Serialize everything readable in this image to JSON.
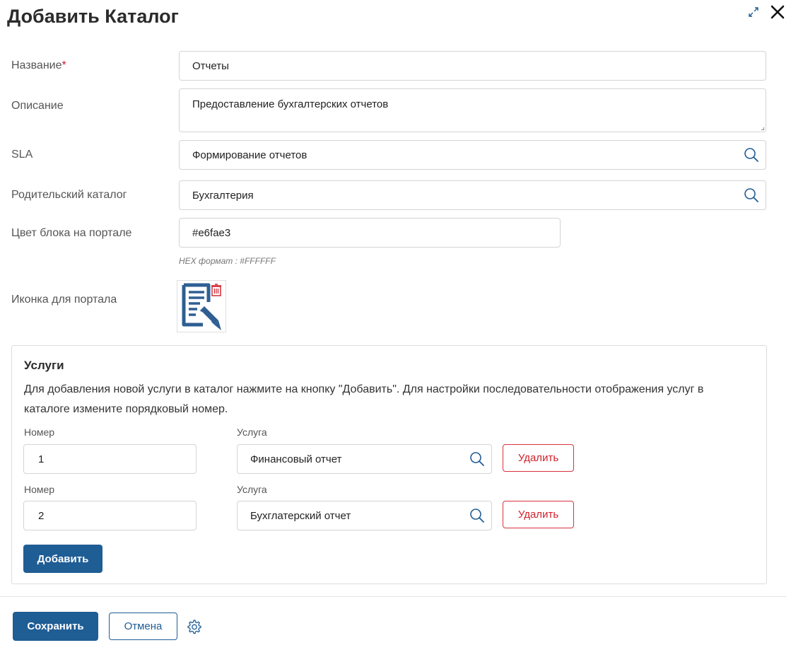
{
  "dialog": {
    "title": "Добавить Каталог"
  },
  "form": {
    "name": {
      "label": "Название",
      "required_mark": "*",
      "value": "Отчеты"
    },
    "description": {
      "label": "Описание",
      "value": "Предоставление бухгалтерских отчетов"
    },
    "sla": {
      "label": "SLA",
      "value": "Формирование отчетов"
    },
    "parent_catalog": {
      "label": "Родительский каталог",
      "value": "Бухгалтерия"
    },
    "block_color": {
      "label": "Цвет блока на портале",
      "value": "#e6fae3",
      "hint": "HEX формат : #FFFFFF"
    },
    "portal_icon": {
      "label": "Иконка для портала",
      "icon": "document-edit-icon"
    }
  },
  "services": {
    "title": "Услуги",
    "description": "Для добавления новой услуги в каталог нажмите на кнопку \"Добавить\". Для настройки последовательности отображения услуг в каталоге измените порядковый номер.",
    "rows": [
      {
        "number_label": "Номер",
        "number": "1",
        "service_label": "Услуга",
        "service": "Финансовый отчет",
        "delete_label": "Удалить"
      },
      {
        "number_label": "Номер",
        "number": "2",
        "service_label": "Услуга",
        "service": "Бухглатерский отчет",
        "delete_label": "Удалить"
      }
    ],
    "add_label": "Добавить"
  },
  "footer": {
    "save_label": "Сохранить",
    "cancel_label": "Отмена"
  },
  "colors": {
    "primary": "#1f5d95",
    "danger": "#d0202a",
    "icon_blue": "#2e5f93"
  }
}
